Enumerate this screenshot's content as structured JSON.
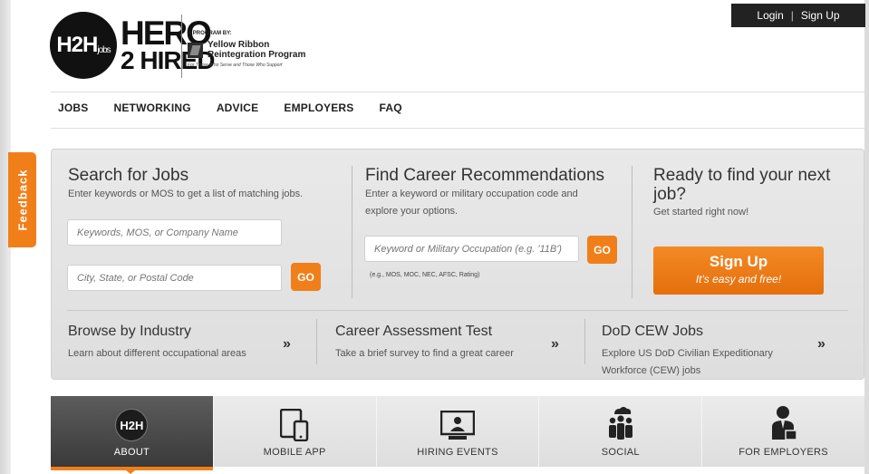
{
  "auth": {
    "login": "Login",
    "separator": "|",
    "signup": "Sign Up"
  },
  "logo": {
    "circle_text": "H2H",
    "circle_sub": "jobs",
    "word1": "HERO",
    "word2": "2 HIRED"
  },
  "program": {
    "by": "A PROGRAM BY:",
    "name_line1": "Yellow Ribbon",
    "name_line2": "Reintegration Program",
    "tagline": "For Those Who Serve and Those Who Support"
  },
  "nav": [
    "JOBS",
    "NETWORKING",
    "ADVICE",
    "EMPLOYERS",
    "FAQ"
  ],
  "feedback": "Feedback",
  "search": {
    "title": "Search for Jobs",
    "desc": "Enter keywords or MOS to get a list of matching jobs.",
    "keywords_placeholder": "Keywords, MOS, or Company Name",
    "location_placeholder": "City, State, or Postal Code",
    "go": "GO"
  },
  "career": {
    "title": "Find Career Recommendations",
    "desc_line1": "Enter a keyword or military occupation code and",
    "desc_line2": "explore your options.",
    "placeholder": "Keyword or Military Occupation (e.g. '11B')",
    "go": "GO",
    "hint": "(e.g., MOS, MOC, NEC, AFSC, Rating)"
  },
  "ready": {
    "title_line1": "Ready to find your next",
    "title_line2": "job?",
    "desc": "Get started right now!",
    "button_main": "Sign Up",
    "button_sub": "It's easy and free!"
  },
  "browse": [
    {
      "title": "Browse by Industry",
      "line1": "Learn about different occupational areas",
      "line2": ""
    },
    {
      "title": "Career Assessment Test",
      "line1": "Take a brief survey to find a great career",
      "line2": ""
    },
    {
      "title": "DoD CEW Jobs",
      "line1": "Explore US DoD Civilian Expeditionary",
      "line2": "Workforce (CEW) jobs"
    }
  ],
  "arrow_glyph": "»",
  "tabs": [
    {
      "label": "ABOUT",
      "icon": "h2h-logo-icon",
      "icon_text": "H2H"
    },
    {
      "label": "MOBILE APP",
      "icon": "mobile-devices-icon"
    },
    {
      "label": "HIRING EVENTS",
      "icon": "presenter-screen-icon"
    },
    {
      "label": "SOCIAL",
      "icon": "people-cloud-icon"
    },
    {
      "label": "FOR EMPLOYERS",
      "icon": "businessman-icon"
    }
  ]
}
